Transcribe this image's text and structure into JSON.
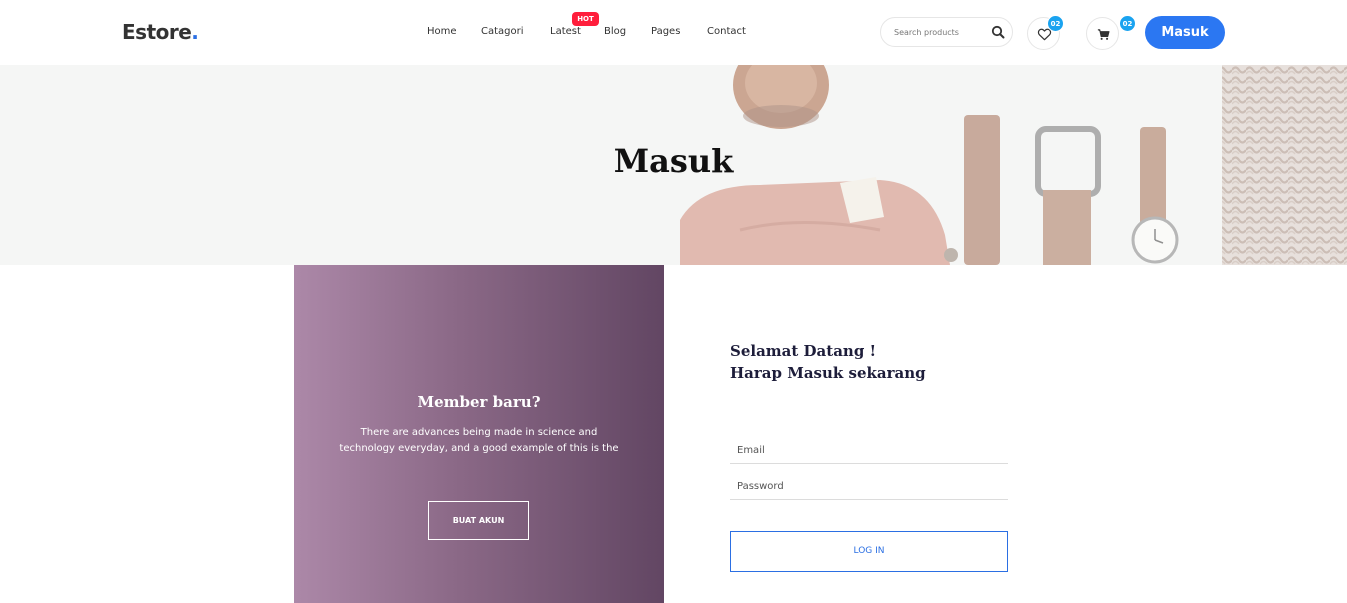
{
  "header": {
    "logo_text": "Estore",
    "logo_dot": ".",
    "nav": {
      "home": "Home",
      "catagori": "Catagori",
      "latest": "Latest",
      "blog": "Blog",
      "pages": "Pages",
      "contact": "Contact"
    },
    "hot_badge": "HOT",
    "search_placeholder": "Search products",
    "wishlist_count": "02",
    "cart_count": "02",
    "login_button": "Masuk"
  },
  "hero": {
    "title": "Masuk"
  },
  "signup_panel": {
    "title": "Member baru?",
    "description": "There are advances being made in science and technology everyday, and a good example of this is the",
    "button": "BUAT AKUN"
  },
  "login_form": {
    "welcome_line1": "Selamat Datang !",
    "welcome_line2": "Harap Masuk sekarang",
    "email_placeholder": "Email",
    "password_placeholder": "Password",
    "submit": "LOG IN"
  },
  "colors": {
    "brand_blue": "#2b77f2",
    "badge_red": "#ff1e3c",
    "badge_cyan": "#1aa3f0",
    "panel_gradient_start": "#ac88a8",
    "panel_gradient_end": "#624663"
  }
}
